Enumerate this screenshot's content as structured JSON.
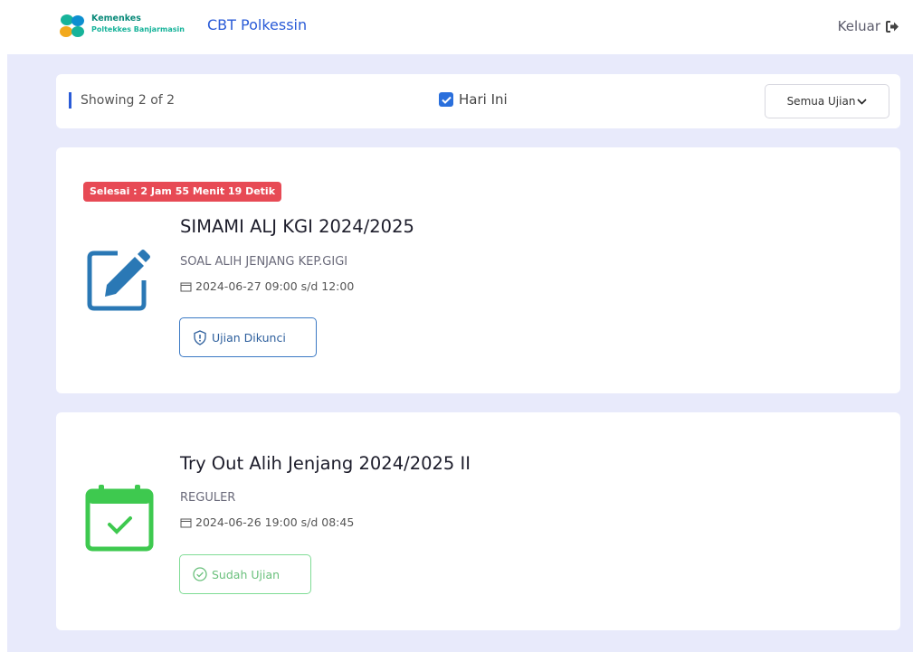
{
  "header": {
    "brand_line1": "Kemenkes",
    "brand_line2": "Poltekkes Banjarmasin",
    "app_title": "CBT Polkessin",
    "logout_label": "Keluar"
  },
  "filter": {
    "showing": "Showing 2 of 2",
    "today_label": "Hari Ini",
    "today_checked": true,
    "exam_select": "Semua Ujian"
  },
  "exams": [
    {
      "badge": "Selesai : 2 Jam 55 Menit 19 Detik",
      "title": "SIMAMI ALJ KGI 2024/2025",
      "subtitle": "SOAL ALIH JENJANG KEP.GIGI",
      "date": "2024-06-27 09:00 s/d 12:00",
      "action": "Ujian Dikunci",
      "icon": "edit-icon",
      "icon_color": "#2a78b5"
    },
    {
      "title": "Try Out Alih Jenjang 2024/2025 II",
      "subtitle": "REGULER",
      "date": "2024-06-26 19:00 s/d 08:45",
      "action": "Sudah Ujian",
      "icon": "calendar-check-icon",
      "icon_color": "#3ec94f"
    }
  ],
  "colors": {
    "accent": "#2a5bd7",
    "badge": "#e74a55",
    "background": "#e8eafb"
  }
}
